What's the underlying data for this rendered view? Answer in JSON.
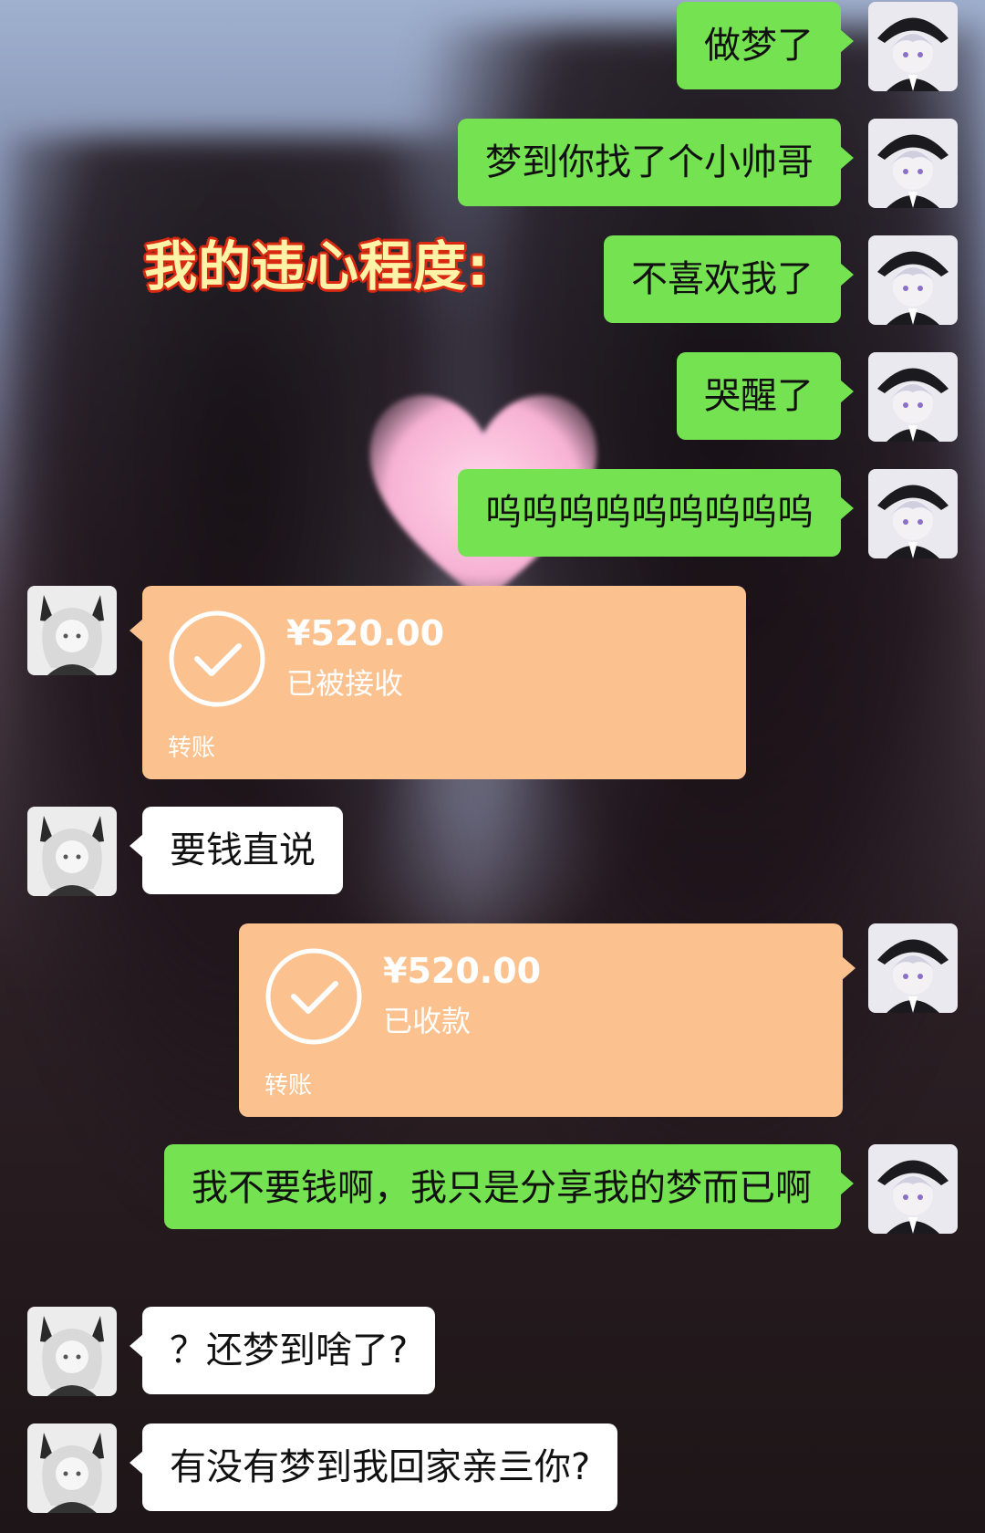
{
  "overlay_caption": "我的违心程度:",
  "colors": {
    "my_bubble": "#75e251",
    "their_bubble": "#ffffff",
    "transfer_card": "#fbc28f",
    "caption_fill": "#fff3a8",
    "caption_outline": "#d92a12"
  },
  "avatars": {
    "me": "white-haired-boy-in-black-hat-avatar",
    "other": "silver-haired-wolf-eared-boy-avatar"
  },
  "messages": [
    {
      "sender": "me",
      "type": "text",
      "text": "做梦了"
    },
    {
      "sender": "me",
      "type": "text",
      "text": "梦到你找了个小帅哥"
    },
    {
      "sender": "me",
      "type": "text",
      "text": "不喜欢我了"
    },
    {
      "sender": "me",
      "type": "text",
      "text": "哭醒了"
    },
    {
      "sender": "me",
      "type": "text",
      "text": "呜呜呜呜呜呜呜呜呜"
    },
    {
      "sender": "other",
      "type": "transfer",
      "amount": "¥520.00",
      "status": "已被接收",
      "label": "转账",
      "icon": "check-circle-icon"
    },
    {
      "sender": "other",
      "type": "text",
      "text": "要钱直说"
    },
    {
      "sender": "me",
      "type": "transfer",
      "amount": "¥520.00",
      "status": "已收款",
      "label": "转账",
      "icon": "check-circle-icon"
    },
    {
      "sender": "me",
      "type": "text",
      "text": "我不要钱啊，我只是分享我的梦而已啊"
    },
    {
      "sender": "other",
      "type": "text",
      "text": "？还梦到啥了?"
    },
    {
      "sender": "other",
      "type": "text",
      "text": "有没有梦到我回家亲亖你?"
    }
  ]
}
